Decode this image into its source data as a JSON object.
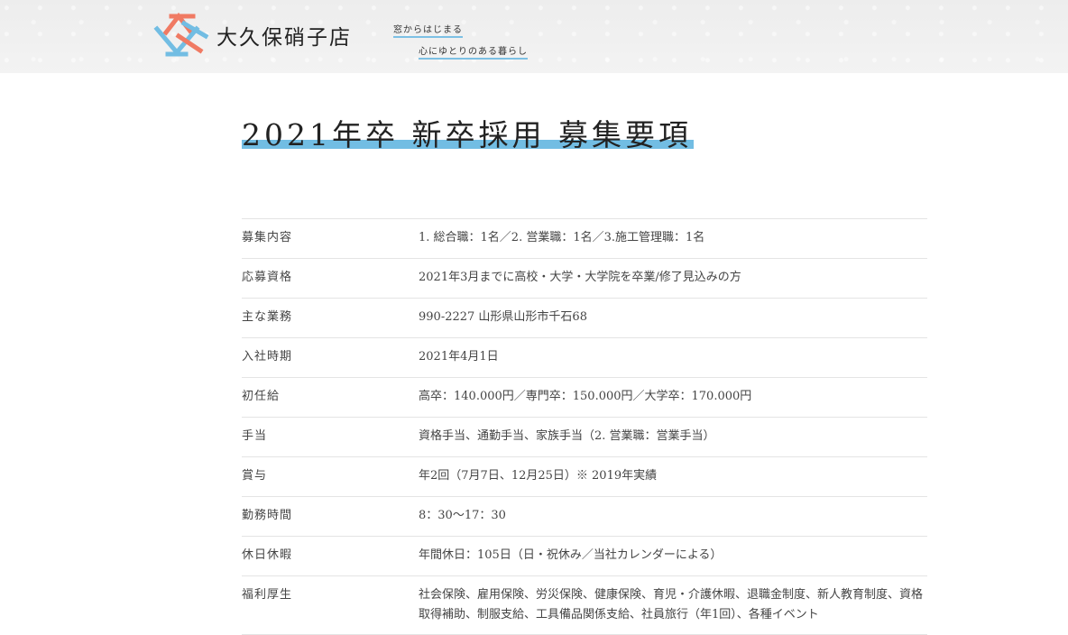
{
  "header": {
    "brand_name": "大久保硝子店",
    "tagline_line1": "窓からはじまる",
    "tagline_line2": "心にゆとりのある暮らし",
    "logo_icon": "lattice-logo-icon",
    "colors": {
      "accent_red": "#f07a63",
      "accent_blue": "#72bde3"
    }
  },
  "page_title": "2021年卒 新卒採用 募集要項",
  "rows": [
    {
      "label": "募集内容",
      "value": "1. 総合職：1名／2. 営業職：1名／3.施工管理職：1名"
    },
    {
      "label": "応募資格",
      "value": "2021年3月までに高校・大学・大学院を卒業/修了見込みの方"
    },
    {
      "label": "主な業務",
      "value": "990-2227 山形県山形市千石68"
    },
    {
      "label": "入社時期",
      "value": "2021年4月1日"
    },
    {
      "label": "初任給",
      "value": "高卒：140.000円／専門卒：150.000円／大学卒：170.000円"
    },
    {
      "label": "手当",
      "value": "資格手当、通勤手当、家族手当（2. 営業職：営業手当）"
    },
    {
      "label": "賞与",
      "value": "年2回（7月7日、12月25日）※ 2019年実績"
    },
    {
      "label": "勤務時間",
      "value": "8：30〜17：30"
    },
    {
      "label": "休日休暇",
      "value": "年間休日：105日（日・祝休み／当社カレンダーによる）"
    },
    {
      "label": "福利厚生",
      "value": "社会保険、雇用保険、労災保険、健康保険、育児・介護休暇、退職金制度、新人教育制度、資格取得補助、制服支給、工具備品関係支給、社員旅行（年1回）、各種イベント"
    }
  ]
}
